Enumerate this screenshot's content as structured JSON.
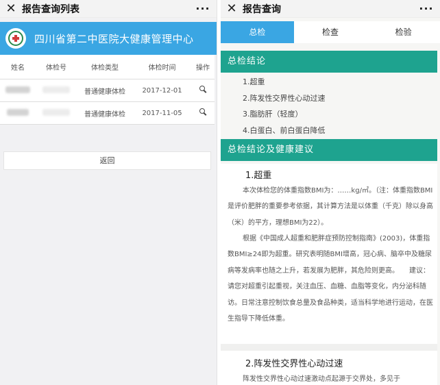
{
  "left": {
    "topbar": {
      "close_icon": "✕",
      "title": "报告查询列表",
      "more_icon": "···"
    },
    "banner": {
      "logo": "hospital-logo",
      "title": "四川省第二中医院大健康管理中心"
    },
    "table": {
      "headers": [
        "姓名",
        "体检号",
        "体检类型",
        "体检时间",
        "操作"
      ],
      "rows": [
        {
          "type": "普通健康体检",
          "date": "2017-12-01"
        },
        {
          "type": "普通健康体检",
          "date": "2017-11-05"
        }
      ]
    },
    "back_label": "返回"
  },
  "right": {
    "topbar": {
      "close_icon": "✕",
      "title": "报告查询",
      "more_icon": "···"
    },
    "tabs": [
      "总检",
      "检查",
      "检验"
    ],
    "active_tab": 0,
    "conclusion_title": "总检结论",
    "conclusions": [
      "1.超重",
      "2.阵发性交界性心动过速",
      "3.脂肪肝（轻度）",
      "4.白蛋白、前白蛋白降低"
    ],
    "advice_title": "总检结论及健康建议",
    "advice": {
      "item1_title": "1.超重",
      "item1_p1": "本次体检您的体重指数BMI为：……kg/㎡。（注：体重指数BMI是评价肥胖的重要参考依据，其计算方法是以体重（千克）除以身高（米）的平方，理想BMI为22）。",
      "item1_p2": "根据《中国成人超重和肥胖症预防控制指南》(2003)，体重指数BMI≥24即为超重。研究表明随BMI增高，冠心病、脑卒中及糖尿病等发病率也随之上升，若发展为肥胖，其危险则更高。　　建议：请您对超重引起重视，关注血压、血糖、血脂等变化，内分泌科随访。日常注意控制饮食总量及食品种类，适当科学地进行运动，在医生指导下降低体重。",
      "item2_title": "2.阵发性交界性心动过速",
      "item2_p1": "阵发性交界性心动过速激动点起源于交界处，多见于"
    }
  },
  "colors": {
    "brand_blue": "#3aa6e3",
    "section_green": "#1ea38f"
  }
}
